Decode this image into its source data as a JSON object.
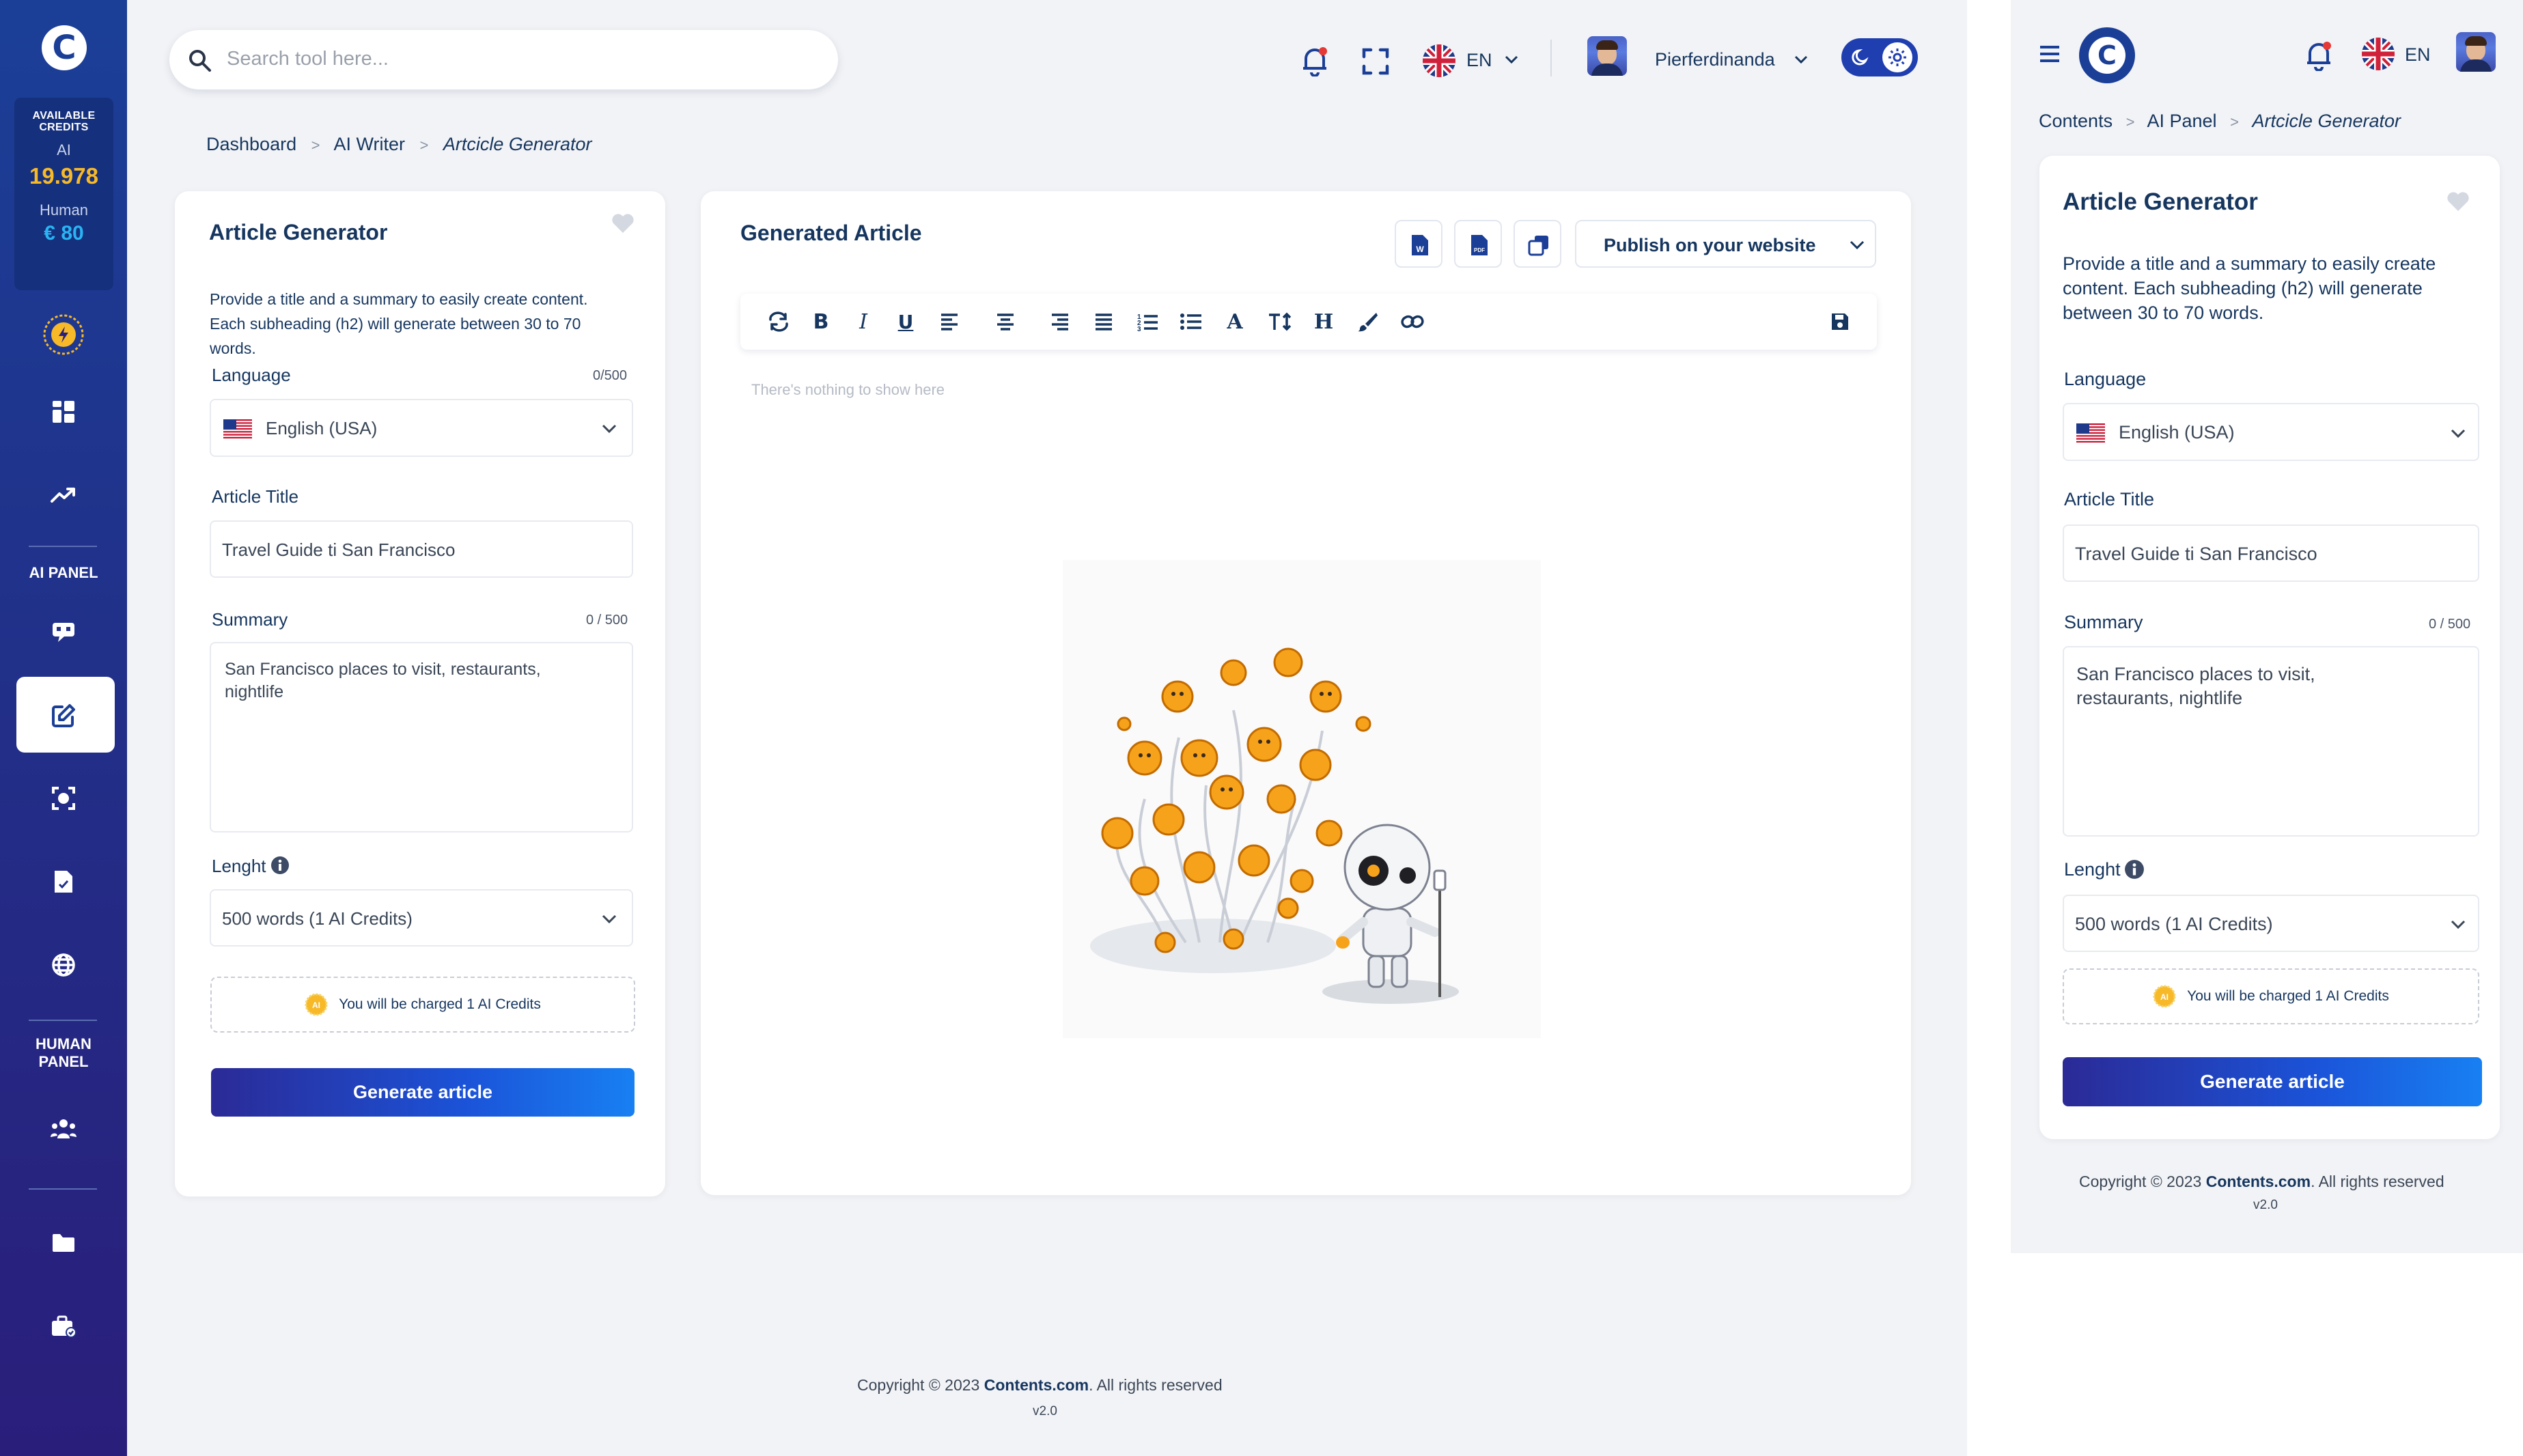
{
  "sidebar": {
    "credits_label": "AVAILABLE CREDITS",
    "ai_label": "AI",
    "ai_value": "19.978",
    "human_label": "Human",
    "human_value": "€ 80",
    "ai_panel_label": "AI PANEL",
    "human_panel_label": "HUMAN PANEL"
  },
  "topbar": {
    "search_placeholder": "Search tool here...",
    "language": "EN",
    "username": "Pierferdinanda"
  },
  "breadcrumb": {
    "items": [
      "Dashboard",
      "AI Writer",
      "Artcicle Generator"
    ],
    "sep": ">"
  },
  "form": {
    "title": "Article Generator",
    "description": "Provide a title and a summary to easily create content. Each subheading (h2) will generate between 30 to 70 words.",
    "language_label": "Language",
    "language_counter": "0/500",
    "language_value": "English (USA)",
    "title_label": "Article Title",
    "title_value": "Travel Guide ti San Francisco",
    "summary_label": "Summary",
    "summary_counter": "0 / 500",
    "summary_value": "San Francisco places to visit, restaurants, nightlife",
    "length_label": "Lenght",
    "length_value": "500 words (1 AI Credits)",
    "charge_text": "You will be charged 1 AI Credits",
    "generate_label": "Generate article"
  },
  "article": {
    "title": "Generated Article",
    "publish_label": "Publish on your website",
    "empty_text": "There's nothing to show here"
  },
  "footer": {
    "copyright_prefix": "Copyright © 2023",
    "brand": "Contents.com",
    "copyright_suffix": ". All rights reserved",
    "version": "v2.0"
  },
  "mobile": {
    "language": "EN",
    "breadcrumb": [
      "Contents",
      "AI Panel",
      "Artcicle Generator"
    ]
  },
  "colors": {
    "brand_blue": "#1b3f97",
    "accent_orange": "#f7b928",
    "human_blue": "#2ab4f4"
  }
}
